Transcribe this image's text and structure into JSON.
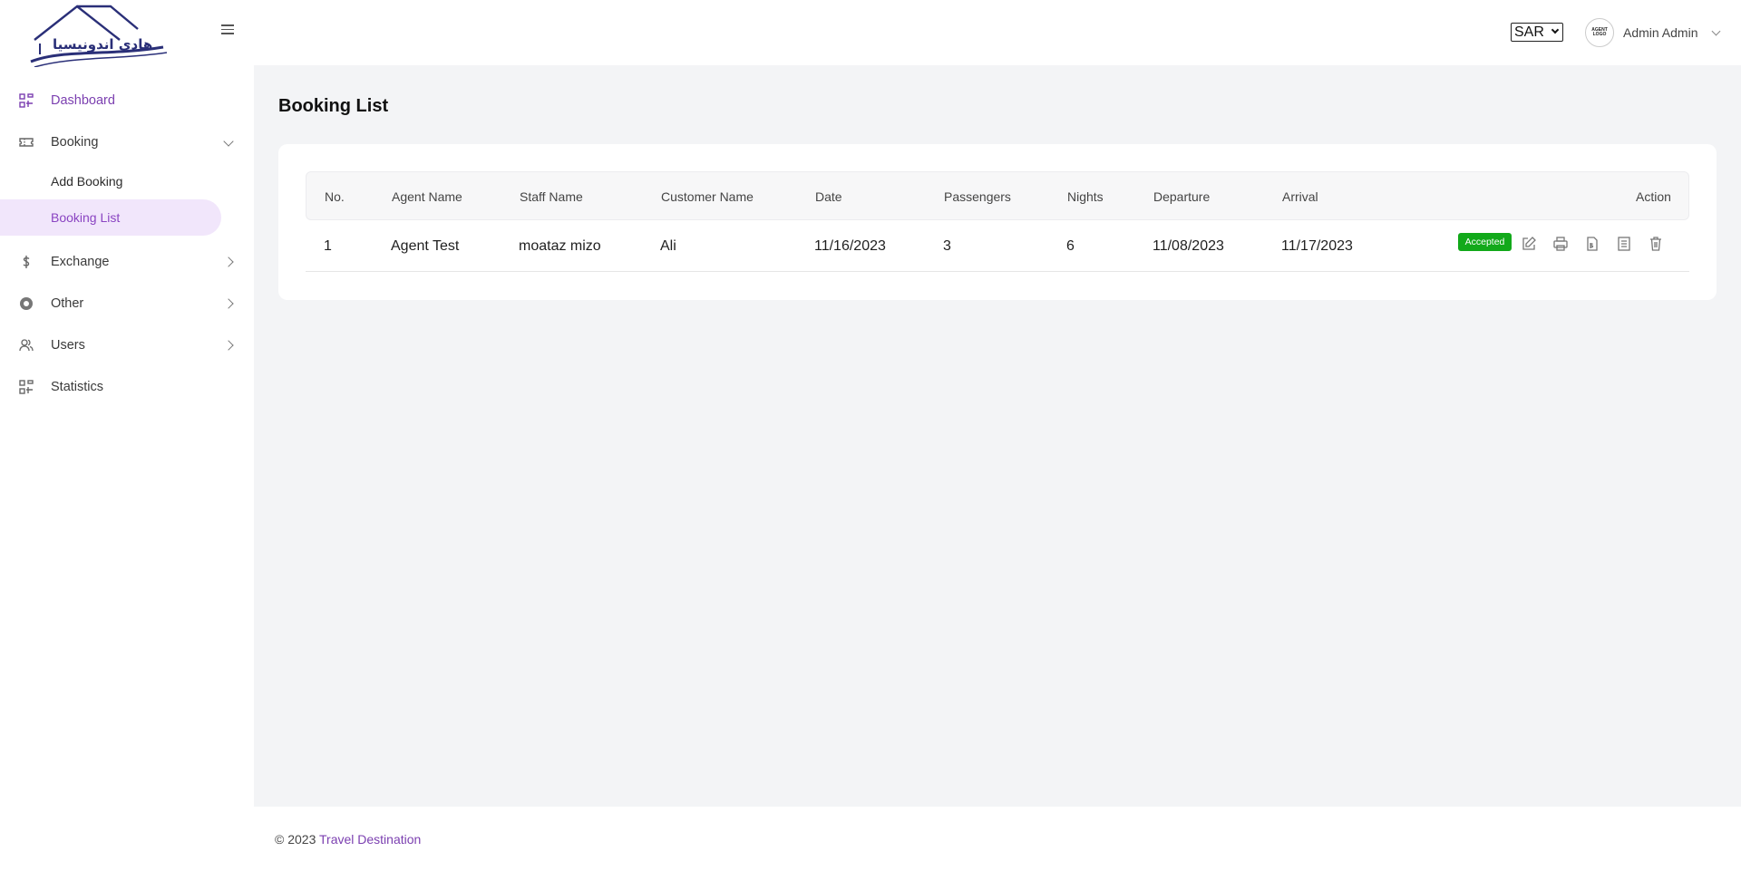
{
  "brand": {
    "logo_text": "هادي اندونيسيا"
  },
  "sidebar": {
    "items": [
      {
        "label": "Dashboard",
        "icon": "dashboard-icon",
        "active": true
      },
      {
        "label": "Booking",
        "icon": "ticket-icon",
        "expanded": true,
        "children": [
          {
            "label": "Add Booking"
          },
          {
            "label": "Booking List",
            "active": true
          }
        ]
      },
      {
        "label": "Exchange",
        "icon": "dollar-icon"
      },
      {
        "label": "Other",
        "icon": "circle-icon"
      },
      {
        "label": "Users",
        "icon": "users-icon"
      },
      {
        "label": "Statistics",
        "icon": "statistics-icon"
      }
    ]
  },
  "header": {
    "currency": "SAR",
    "avatar_text": "AGENT LOGO",
    "user_name": "Admin Admin"
  },
  "main": {
    "title": "Booking List",
    "table": {
      "columns": [
        "No.",
        "Agent Name",
        "Staff Name",
        "Customer Name",
        "Date",
        "Passengers",
        "Nights",
        "Departure",
        "Arrival",
        "Action"
      ],
      "rows": [
        {
          "no": "1",
          "agent_name": "Agent Test",
          "staff_name": "moataz mizo",
          "customer_name": "Ali",
          "date": "11/16/2023",
          "passengers": "3",
          "nights": "6",
          "departure": "11/08/2023",
          "arrival": "11/17/2023",
          "status": "Accepted",
          "actions": [
            "edit-icon",
            "print-icon",
            "invoice-icon",
            "document-icon",
            "trash-icon"
          ]
        }
      ]
    }
  },
  "footer": {
    "copyright": "© 2023",
    "brand": "Travel Destination"
  },
  "colors": {
    "accent": "#7b3fb0",
    "active_bg": "#f1e6fb",
    "status_accepted": "#12a91a",
    "page_bg": "#f3f4f6"
  }
}
